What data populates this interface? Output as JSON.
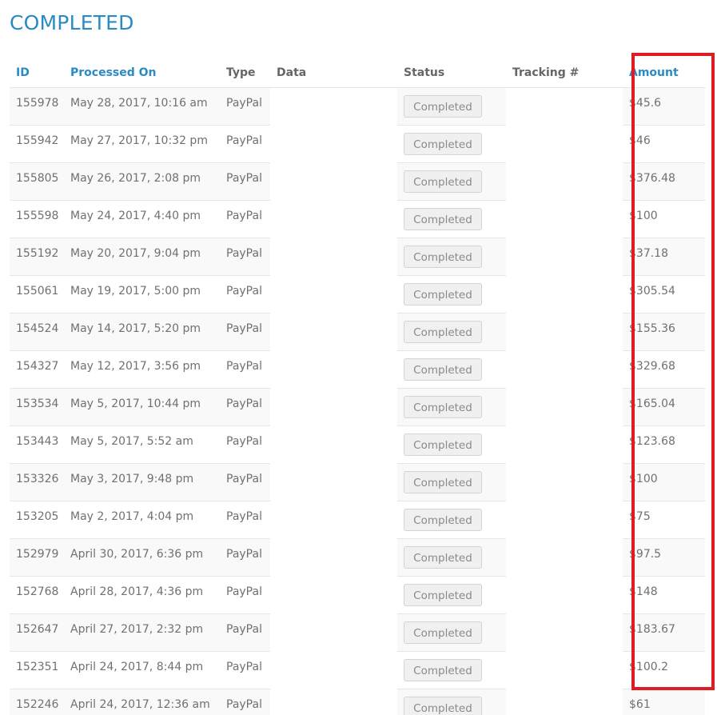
{
  "section_title": "COMPLETED",
  "columns": {
    "id": "ID",
    "processed_on": "Processed On",
    "type": "Type",
    "data": "Data",
    "status": "Status",
    "tracking": "Tracking #",
    "amount": "Amount"
  },
  "colors": {
    "accent": "#2a8bc4",
    "highlight": "#e01b24"
  },
  "rows": [
    {
      "id": "155978",
      "processed_on": "May 28, 2017, 10:16 am",
      "type": "PayPal",
      "status": "Completed",
      "amount": "$45.6"
    },
    {
      "id": "155942",
      "processed_on": "May 27, 2017, 10:32 pm",
      "type": "PayPal",
      "status": "Completed",
      "amount": "$46"
    },
    {
      "id": "155805",
      "processed_on": "May 26, 2017, 2:08 pm",
      "type": "PayPal",
      "status": "Completed",
      "amount": "$376.48"
    },
    {
      "id": "155598",
      "processed_on": "May 24, 2017, 4:40 pm",
      "type": "PayPal",
      "status": "Completed",
      "amount": "$100"
    },
    {
      "id": "155192",
      "processed_on": "May 20, 2017, 9:04 pm",
      "type": "PayPal",
      "status": "Completed",
      "amount": "$37.18"
    },
    {
      "id": "155061",
      "processed_on": "May 19, 2017, 5:00 pm",
      "type": "PayPal",
      "status": "Completed",
      "amount": "$305.54"
    },
    {
      "id": "154524",
      "processed_on": "May 14, 2017, 5:20 pm",
      "type": "PayPal",
      "status": "Completed",
      "amount": "$155.36"
    },
    {
      "id": "154327",
      "processed_on": "May 12, 2017, 3:56 pm",
      "type": "PayPal",
      "status": "Completed",
      "amount": "$329.68"
    },
    {
      "id": "153534",
      "processed_on": "May 5, 2017, 10:44 pm",
      "type": "PayPal",
      "status": "Completed",
      "amount": "$165.04"
    },
    {
      "id": "153443",
      "processed_on": "May 5, 2017, 5:52 am",
      "type": "PayPal",
      "status": "Completed",
      "amount": "$123.68"
    },
    {
      "id": "153326",
      "processed_on": "May 3, 2017, 9:48 pm",
      "type": "PayPal",
      "status": "Completed",
      "amount": "$100"
    },
    {
      "id": "153205",
      "processed_on": "May 2, 2017, 4:04 pm",
      "type": "PayPal",
      "status": "Completed",
      "amount": "$75"
    },
    {
      "id": "152979",
      "processed_on": "April 30, 2017, 6:36 pm",
      "type": "PayPal",
      "status": "Completed",
      "amount": "$97.5"
    },
    {
      "id": "152768",
      "processed_on": "April 28, 2017, 4:36 pm",
      "type": "PayPal",
      "status": "Completed",
      "amount": "$148"
    },
    {
      "id": "152647",
      "processed_on": "April 27, 2017, 2:32 pm",
      "type": "PayPal",
      "status": "Completed",
      "amount": "$183.67"
    },
    {
      "id": "152351",
      "processed_on": "April 24, 2017, 8:44 pm",
      "type": "PayPal",
      "status": "Completed",
      "amount": "$100.2"
    },
    {
      "id": "152246",
      "processed_on": "April 24, 2017, 12:36 am",
      "type": "PayPal",
      "status": "Completed",
      "amount": "$61"
    }
  ]
}
